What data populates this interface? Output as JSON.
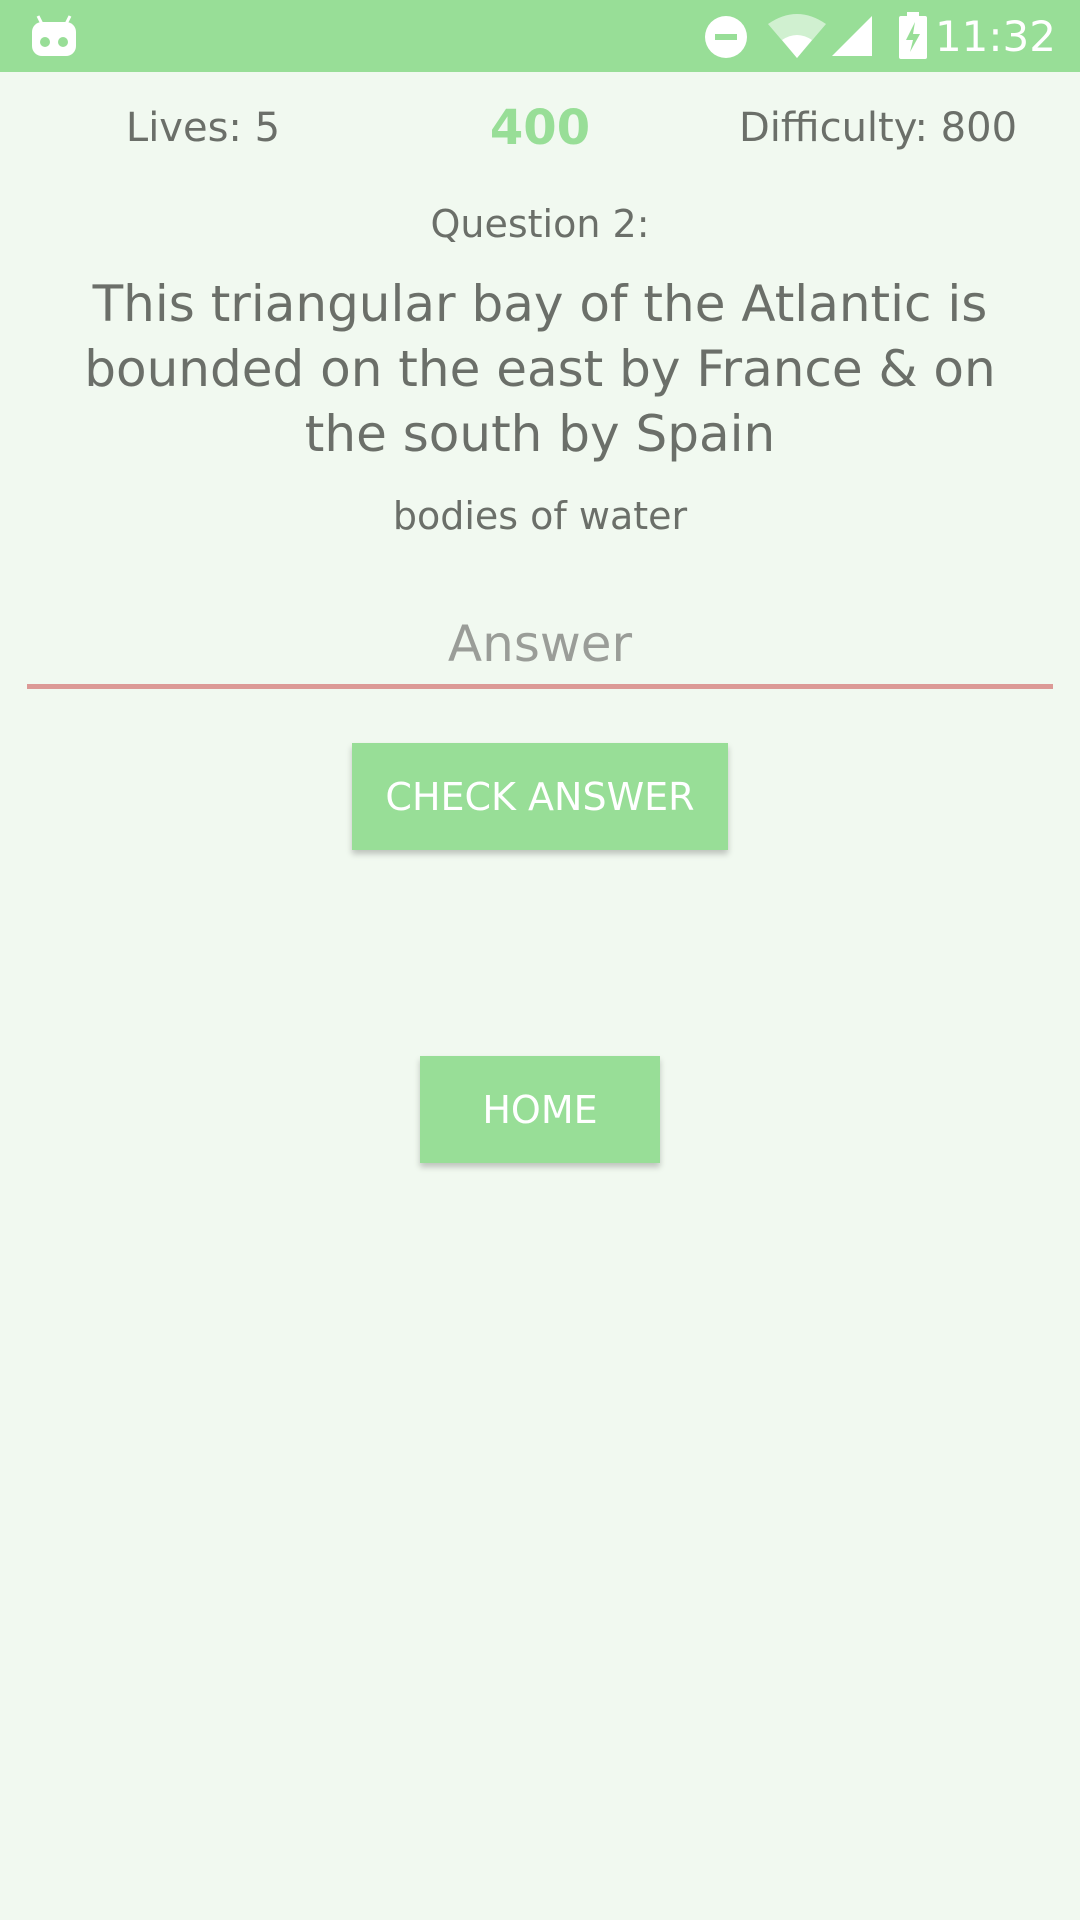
{
  "status_bar": {
    "time": "11:32",
    "icons": [
      "android-icon",
      "do-not-disturb-icon",
      "wifi-icon",
      "cell-signal-icon",
      "battery-charging-icon"
    ],
    "background_color": "#98de97"
  },
  "stats": {
    "lives": "Lives: 5",
    "score": "400",
    "difficulty": "Difficulty: 800"
  },
  "question": {
    "number": "Question 2:",
    "text": "This triangular bay of the Atlantic is bounded on the east by France & on the south by Spain",
    "category": "bodies of water"
  },
  "answer": {
    "value": "",
    "placeholder": "Answer"
  },
  "buttons": {
    "check_answer": "CHECK ANSWER",
    "home": "HOME"
  },
  "colors": {
    "accent_green": "#98de97",
    "background": "#f1f9f0",
    "text": "#6b6f69",
    "underline": "#dc9a96"
  }
}
